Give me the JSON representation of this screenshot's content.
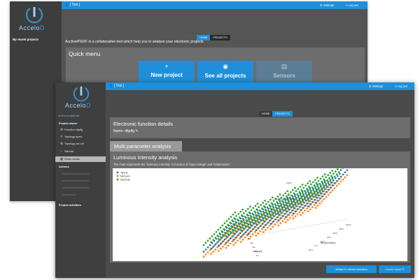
{
  "back_window": {
    "brand_a": "Accelo",
    "brand_b": "D",
    "recent_projects": "My recent projects",
    "user": "[ Test ]",
    "settings": "Settings",
    "logout": "Log out",
    "tabs": [
      "HOME",
      "PROJECTS"
    ],
    "description": "Acctive/PERF is a collaborative tool which help you to analyse your electronic projects",
    "quick_menu": {
      "title": "Quick menu",
      "buttons": [
        {
          "icon": "+",
          "label": "New project"
        },
        {
          "icon": "◉",
          "label": "See all projects"
        },
        {
          "icon": "▤",
          "label": "Sensors"
        }
      ]
    }
  },
  "front_window": {
    "brand_a": "Accelo",
    "brand_b": "D",
    "user": "[ Test ]",
    "settings": "Settings",
    "logout": "Log out",
    "tabs": [
      "HOME",
      "PROJECTS"
    ],
    "sidebar": {
      "back_link": "◂ Go to project list",
      "project_owner": "Project owner",
      "items": [
        {
          "icon": "⚙",
          "label": "Function dfgdfg"
        },
        {
          "icon": "✕",
          "label": "Topology types"
        },
        {
          "icon": "⚙",
          "label": "Topology set-um"
        },
        {
          "icon": "↕",
          "label": "Stimulis"
        },
        {
          "icon": "▦",
          "label": "Static results"
        }
      ],
      "actions": "Actions",
      "project_activities": "Project activities"
    },
    "efd": {
      "title": "Electronic function details",
      "name_label": "Name: dfgdfg"
    },
    "mpa_tab": "Multi parameter analysis",
    "chart_title": "Luminous intensity analysis",
    "chart_desc": "The chart represents the 'luminous intensity' in function of 'input voltage' and 'temperature'.",
    "buttons": {
      "back": "◂ Back to stimuli selection",
      "report": "Create report"
    }
  },
  "chart_data": {
    "type": "scatter",
    "title": "",
    "xlabel": "Vsupply",
    "ylabel": "Temperature",
    "zlabel": "Luminous intensity",
    "legend_position": "top-left",
    "series": [
      {
        "name": "Typical",
        "color": "#1f77b4",
        "values": []
      },
      {
        "name": "Minimum",
        "color": "#ff7f0e",
        "values": []
      },
      {
        "name": "Maximum",
        "color": "#2ca02c",
        "values": []
      }
    ],
    "ticks_x": [
      "14V",
      "13V",
      "12V",
      "11V",
      "10V",
      "9V"
    ],
    "ticks_y": [
      "100°C",
      "80°C",
      "60°C",
      "40°C",
      "20°C",
      "0°C",
      "-20°C"
    ],
    "ticks_z": [
      "0.8cd",
      "0.6cd"
    ]
  }
}
